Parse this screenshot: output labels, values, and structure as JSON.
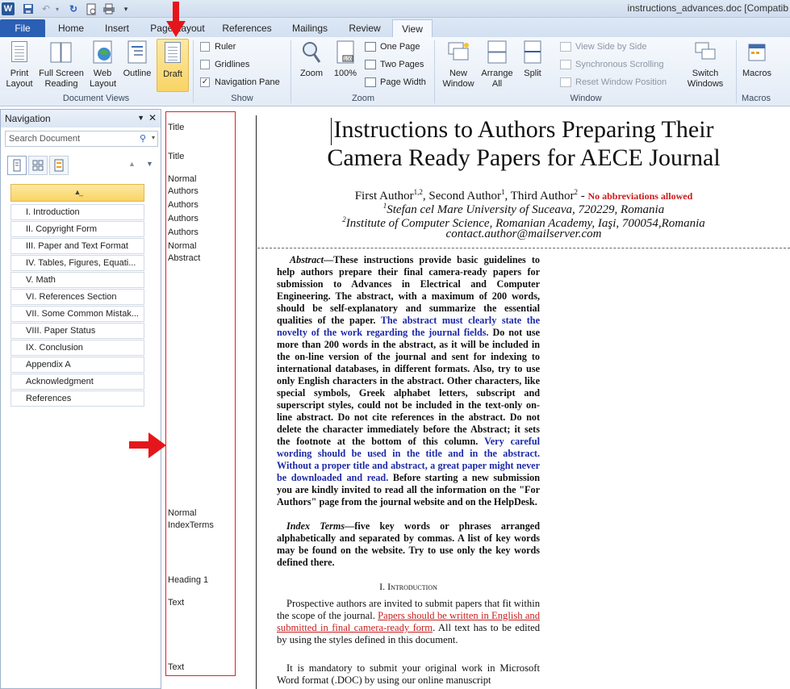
{
  "window": {
    "title": "instructions_advances.doc [Compatib"
  },
  "tabs": [
    "File",
    "Home",
    "Insert",
    "Page Layout",
    "References",
    "Mailings",
    "Review",
    "View"
  ],
  "ribbon": {
    "doc_views": {
      "label": "Document Views",
      "print_layout": "Print Layout",
      "full_screen": "Full Screen Reading",
      "web_layout": "Web Layout",
      "outline": "Outline",
      "draft": "Draft"
    },
    "show": {
      "label": "Show",
      "ruler": "Ruler",
      "gridlines": "Gridlines",
      "navigation_pane": "Navigation Pane"
    },
    "zoom": {
      "label": "Zoom",
      "zoom": "Zoom",
      "hundred": "100%",
      "one_page": "One Page",
      "two_pages": "Two Pages",
      "page_width": "Page Width"
    },
    "window": {
      "label": "Window",
      "new_window": "New Window",
      "arrange_all": "Arrange All",
      "split": "Split",
      "side_by_side": "View Side by Side",
      "sync_scroll": "Synchronous Scrolling",
      "reset_position": "Reset Window Position",
      "switch_windows": "Switch Windows"
    },
    "macros": {
      "label": "Macros",
      "macros": "Macros"
    }
  },
  "navigation": {
    "title": "Navigation",
    "search_placeholder": "Search Document",
    "items": [
      "I. Introduction",
      "II. Copyright Form",
      "III. Paper and Text Format",
      "IV. Tables, Figures, Equati...",
      "V. Math",
      "VI. References Section",
      "VII. Some Common Mistak...",
      "VIII. Paper Status",
      "IX. Conclusion",
      "Appendix A",
      "Acknowledgment",
      "References"
    ]
  },
  "style_area": {
    "styles": [
      "Title",
      "Title",
      "Normal",
      "Authors",
      "Authors",
      "Authors",
      "Authors",
      "Normal",
      "Abstract",
      "Normal",
      "IndexTerms",
      "Heading 1",
      "Text",
      "Text"
    ]
  },
  "document": {
    "title_line1": "Instructions to Authors Preparing Their",
    "title_line2": "Camera Ready Papers for AECE Journal",
    "authors": "First Author",
    "sup1": "1,2",
    "authors_b": ", Second Author",
    "sup2": "1",
    "authors_c": ", Third Author",
    "sup3": "2",
    "authors_d": " - ",
    "no_abbrev": "No abbreviations allowed",
    "aff1_sup": "1",
    "aff1": "Stefan cel Mare University of Suceava, 720229, Romania",
    "aff2_sup": "2",
    "aff2": "Institute of Computer Science, Romanian Academy, Iaşi, 700054,Romania",
    "contact": "contact.author@mailserver.com",
    "abstract_label": "Abstract",
    "abstract_dash": "—",
    "abstract_p1": "These instructions provide basic guidelines to help authors prepare their final camera-ready papers for submission to Advances in Electrical and Computer Engineering. The abstract, with a maximum of 200 words, should be self-explanatory and summarize the essential qualities of the paper.",
    "abstract_blue1": "The abstract must clearly state the novelty of the work regarding the journal fields.",
    "abstract_p2": "Do not use more than 200 words in the abstract, as it will be included in the on-line version of the journal and sent for indexing to international databases, in different formats. Also, try to use only English characters in the abstract. Other characters, like special symbols, Greek alphabet letters, subscript and superscript styles, could not be included in the text-only on-line abstract. Do not cite references in the abstract. Do not delete the character immediately before the Abstract; it sets the footnote at the bottom of this column.",
    "abstract_blue2": "Very careful wording should be used in the title and in the abstract.  Without a proper title and abstract, a great paper might never be downloaded and read.",
    "abstract_p3": "Before starting a new submission you are kindly invited to read all the information on the \"For Authors\" page from the journal website and on the HelpDesk.",
    "index_label": "Index Terms",
    "index_text": "five key words or phrases arranged alphabetically and separated by commas. A list of key words may be found on the website. Try to use only the key words defined there.",
    "heading1": "I.   Introduction",
    "body_p1a": "Prospective authors are invited to submit papers that fit within the scope of the journal.",
    "body_p1_red": "Papers should be written in English and submitted in final camera-ready form",
    "body_p1b": ". All text has to be edited by using the styles defined in this document.",
    "body_p2": "It is mandatory to submit your original work in Microsoft Word format (.DOC) by using our online manuscript"
  }
}
